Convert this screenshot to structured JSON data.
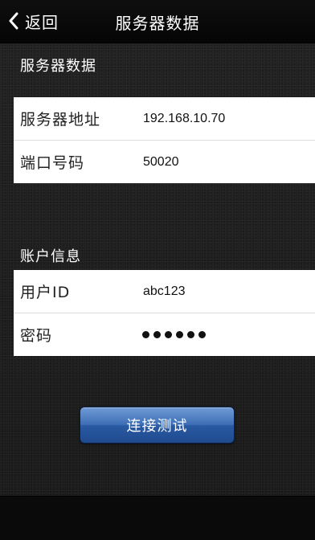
{
  "navbar": {
    "back_label": "返回",
    "title": "服务器数据"
  },
  "server_section": {
    "header": "服务器数据",
    "rows": [
      {
        "label": "服务器地址",
        "value": "192.168.10.70"
      },
      {
        "label": "端口号码",
        "value": "50020"
      }
    ]
  },
  "account_section": {
    "header": "账户信息",
    "rows": [
      {
        "label": "用户ID",
        "value": "abc123"
      },
      {
        "label": "密码",
        "value": "••••••",
        "masked_length": 6
      }
    ]
  },
  "actions": {
    "connect_test_label": "连接测试"
  },
  "colors": {
    "background": "#1e1e1e",
    "navbar": "#0a0a0a",
    "button_blue": "#2a5aa3",
    "row_bg": "#ffffff"
  }
}
